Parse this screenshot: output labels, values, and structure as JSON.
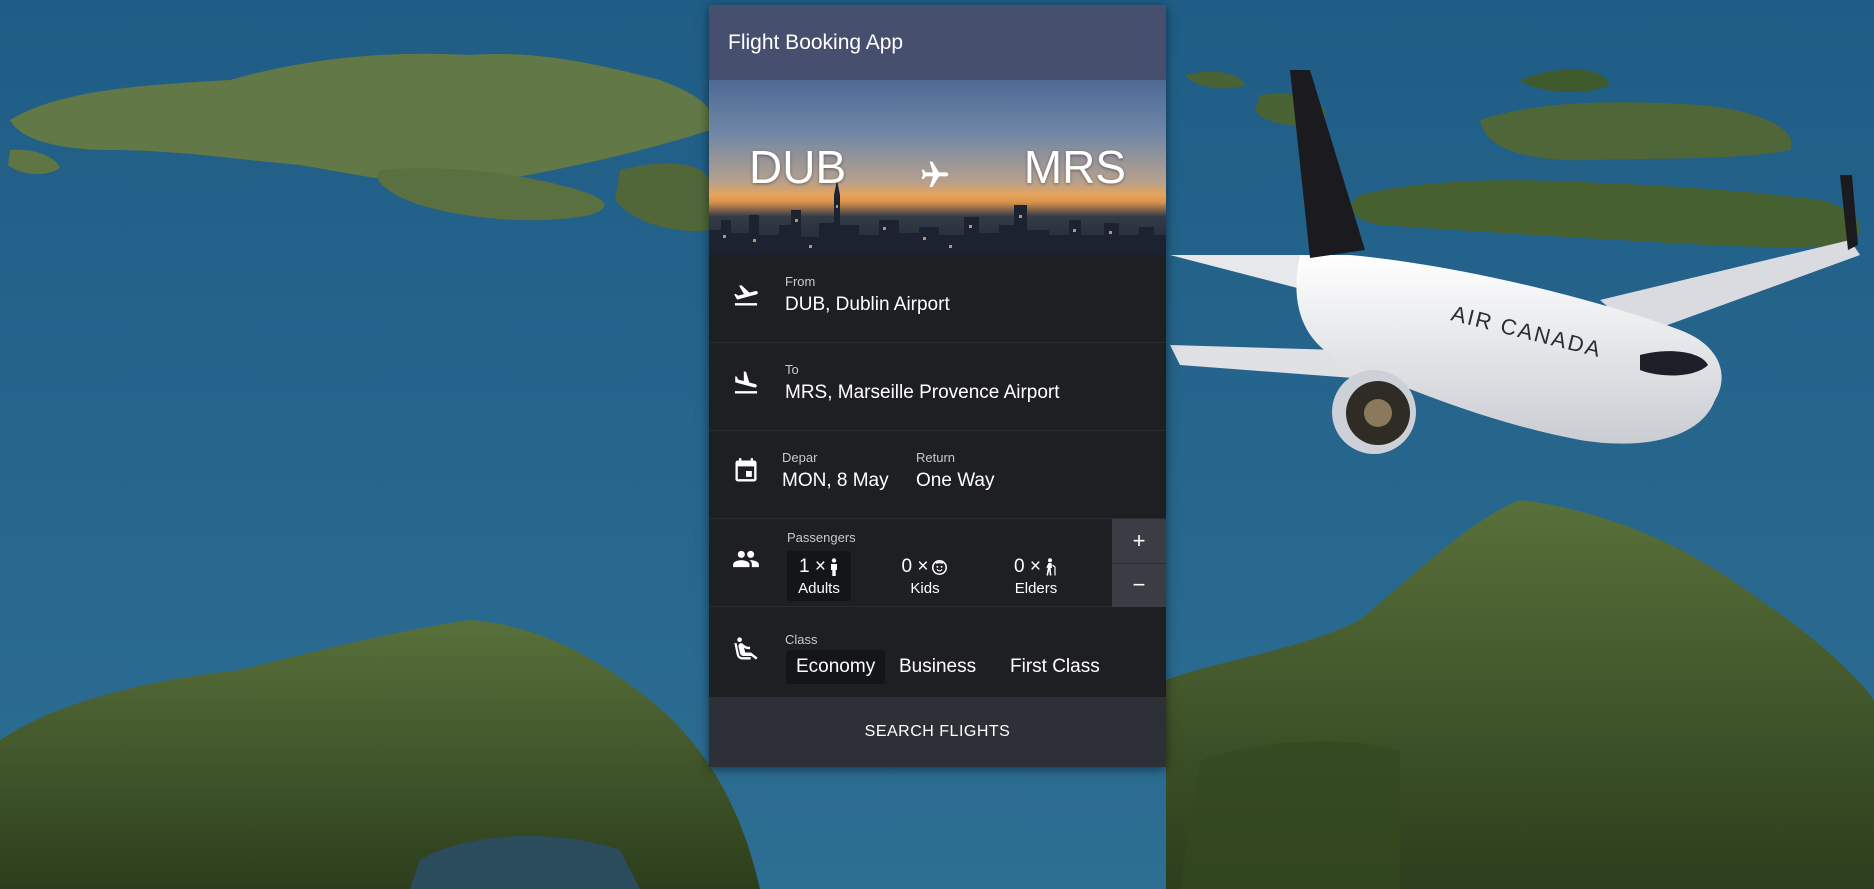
{
  "app": {
    "title": "Flight Booking App"
  },
  "hero": {
    "from_code": "DUB",
    "to_code": "MRS"
  },
  "from": {
    "label": "From",
    "value": "DUB, Dublin Airport"
  },
  "to": {
    "label": "To",
    "value": "MRS, Marseille Provence Airport"
  },
  "dates": {
    "depart_label": "Depar",
    "depart_value": "MON, 8 May",
    "return_label": "Return",
    "return_value": "One Way"
  },
  "passengers": {
    "label": "Passengers",
    "adults": {
      "count": "1 ×",
      "name": "Adults"
    },
    "kids": {
      "count": "0 ×",
      "name": "Kids"
    },
    "elders": {
      "count": "0 ×",
      "name": "Elders"
    },
    "increment": "+",
    "decrement": "−"
  },
  "travel_class": {
    "label": "Class",
    "options": [
      "Economy",
      "Business",
      "First Class"
    ],
    "selected": "Economy"
  },
  "search_button": "SEARCH FLIGHTS",
  "plane_livery": "AIR CANADA",
  "colors": {
    "header": "#46506e",
    "card": "#1e1f23",
    "selected": "#141518",
    "button": "#2e3037"
  }
}
